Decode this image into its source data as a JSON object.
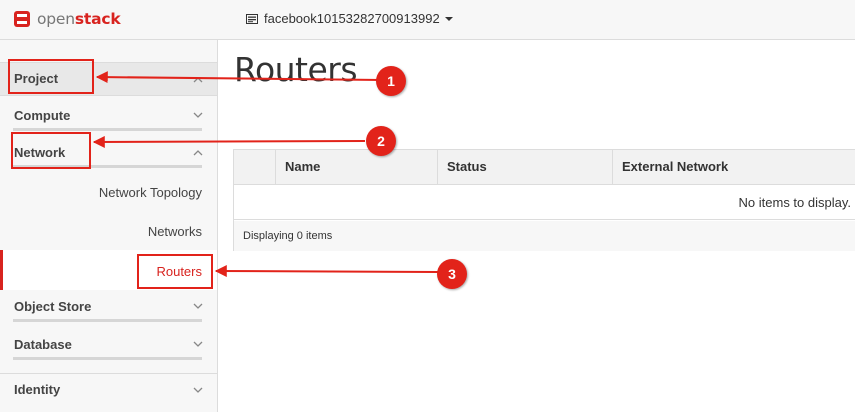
{
  "topbar": {
    "logo_open": "open",
    "logo_stack": "stack",
    "project_name": "facebook10153282700913992"
  },
  "sidebar": {
    "project": "Project",
    "compute": "Compute",
    "network": "Network",
    "network_topology": "Network Topology",
    "networks": "Networks",
    "routers": "Routers",
    "object_store": "Object Store",
    "database": "Database",
    "identity": "Identity"
  },
  "main": {
    "title": "Routers",
    "table": {
      "columns": [
        "Name",
        "Status",
        "External Network"
      ],
      "empty_message": "No items to display.",
      "footer": "Displaying 0 items"
    }
  },
  "annotations": {
    "badges": [
      "1",
      "2",
      "3"
    ],
    "color": "#e2231a"
  },
  "colors": {
    "brand_red": "#d8231f",
    "sidebar_bg": "#f7f7f7",
    "table_header_bg": "#f2f2f2"
  }
}
